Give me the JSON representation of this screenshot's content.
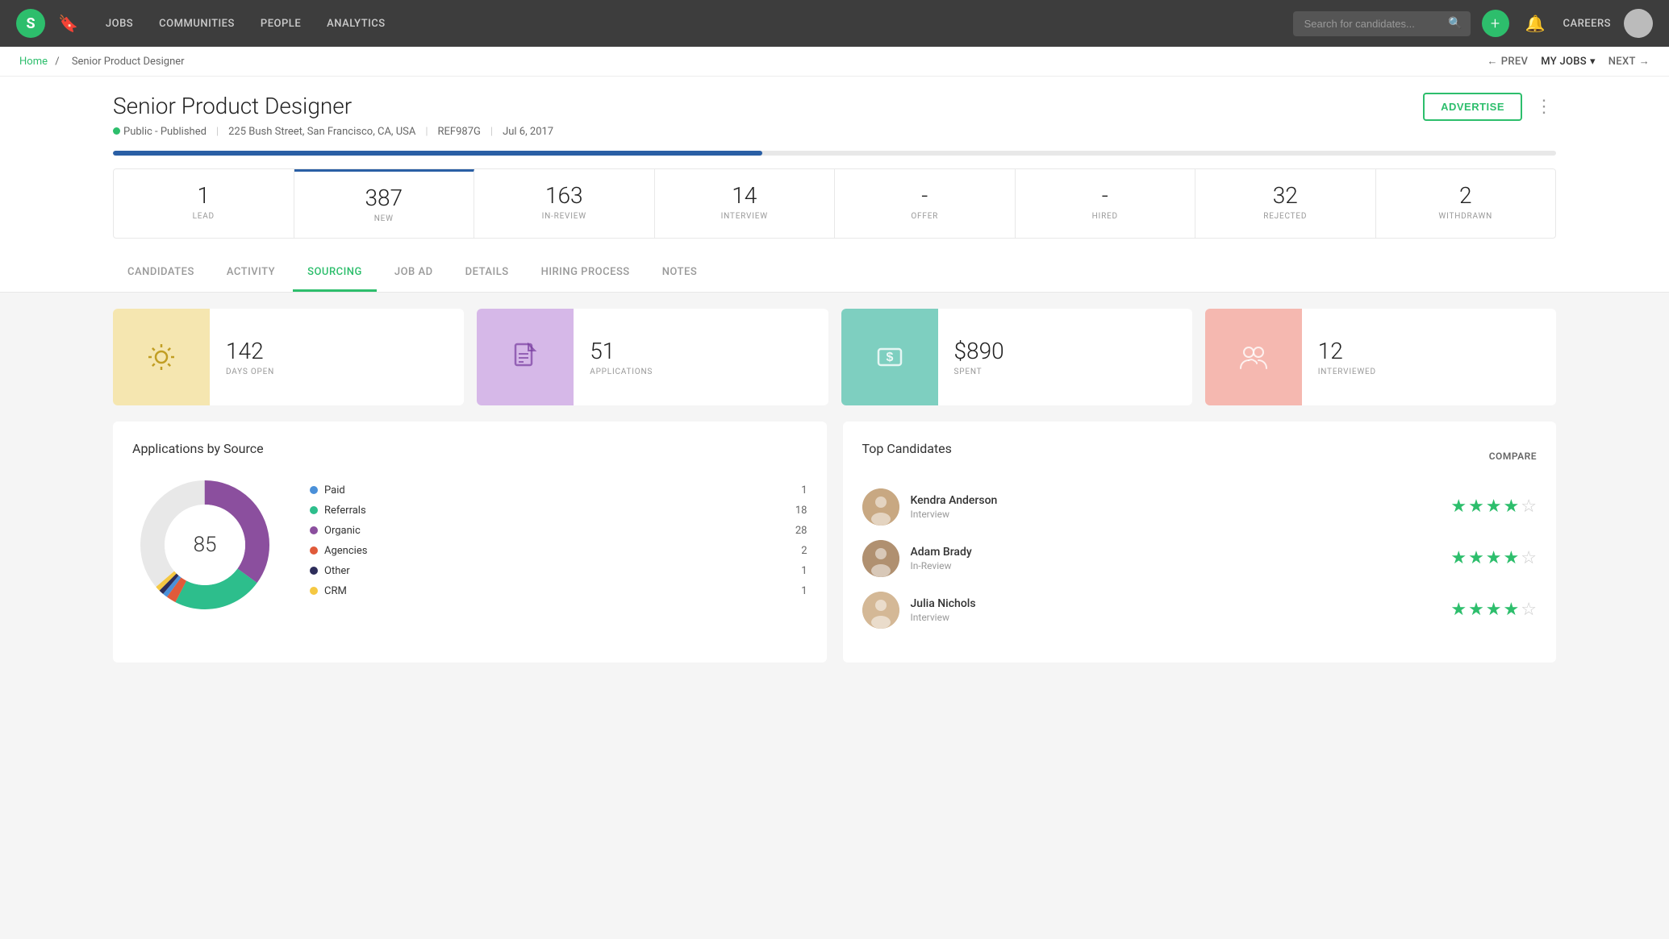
{
  "nav": {
    "logo": "S",
    "links": [
      {
        "label": "JOBS",
        "active": false
      },
      {
        "label": "COMMUNITIES",
        "active": false
      },
      {
        "label": "PEOPLE",
        "active": false
      },
      {
        "label": "ANALYTICS",
        "active": false
      }
    ],
    "search_placeholder": "Search for candidates...",
    "careers_label": "CAREERS",
    "my_jobs_label": "MY JOBS"
  },
  "breadcrumb": {
    "home": "Home",
    "separator": "/",
    "current": "Senior Product Designer",
    "prev_label": "PREV",
    "next_label": "NEXT"
  },
  "job": {
    "title": "Senior Product Designer",
    "status": "Public - Published",
    "location": "225 Bush Street, San Francisco, CA, USA",
    "ref": "REF987G",
    "date": "Jul 6, 2017",
    "advertise_label": "ADVERTISE"
  },
  "stats": {
    "progress_pct": 45,
    "items": [
      {
        "value": "1",
        "label": "LEAD",
        "highlighted": false
      },
      {
        "value": "387",
        "label": "NEW",
        "highlighted": true
      },
      {
        "value": "163",
        "label": "IN-REVIEW",
        "highlighted": false
      },
      {
        "value": "14",
        "label": "INTERVIEW",
        "highlighted": false
      },
      {
        "value": "-",
        "label": "OFFER",
        "highlighted": false
      },
      {
        "value": "-",
        "label": "HIRED",
        "highlighted": false
      },
      {
        "value": "32",
        "label": "REJECTED",
        "highlighted": false
      },
      {
        "value": "2",
        "label": "WITHDRAWN",
        "highlighted": false
      }
    ]
  },
  "tabs": [
    {
      "label": "CANDIDATES",
      "active": false
    },
    {
      "label": "ACTIVITY",
      "active": false
    },
    {
      "label": "SOURCING",
      "active": true
    },
    {
      "label": "JOB AD",
      "active": false
    },
    {
      "label": "DETAILS",
      "active": false
    },
    {
      "label": "HIRING PROCESS",
      "active": false
    },
    {
      "label": "NOTES",
      "active": false
    }
  ],
  "sourcing_cards": [
    {
      "icon": "sun",
      "color": "yellow",
      "value": "142",
      "label": "DAYS OPEN"
    },
    {
      "icon": "doc",
      "color": "purple",
      "value": "51",
      "label": "APPLICATIONS"
    },
    {
      "icon": "dollar",
      "color": "teal",
      "value": "$890",
      "label": "SPENT"
    },
    {
      "icon": "people",
      "color": "pink",
      "value": "12",
      "label": "INTERVIEWED"
    }
  ],
  "chart": {
    "title": "Applications by Source",
    "center_value": "85",
    "legend": [
      {
        "label": "Paid",
        "count": "1",
        "color": "#4a90d9"
      },
      {
        "label": "Referrals",
        "count": "18",
        "color": "#2dbe8c"
      },
      {
        "label": "Organic",
        "count": "28",
        "color": "#8b4f9e"
      },
      {
        "label": "Agencies",
        "count": "2",
        "color": "#e05a3a"
      },
      {
        "label": "Other",
        "count": "1",
        "color": "#2d2d5a"
      },
      {
        "label": "CRM",
        "count": "1",
        "color": "#f5c842"
      }
    ]
  },
  "top_candidates": {
    "title": "Top Candidates",
    "compare_label": "COMPARE",
    "candidates": [
      {
        "name": "Kendra Anderson",
        "stage": "Interview",
        "stars": 4,
        "half": true
      },
      {
        "name": "Adam Brady",
        "stage": "In-Review",
        "stars": 4,
        "half": true
      },
      {
        "name": "Julia Nichols",
        "stage": "Interview",
        "stars": 4,
        "half": false
      }
    ]
  }
}
